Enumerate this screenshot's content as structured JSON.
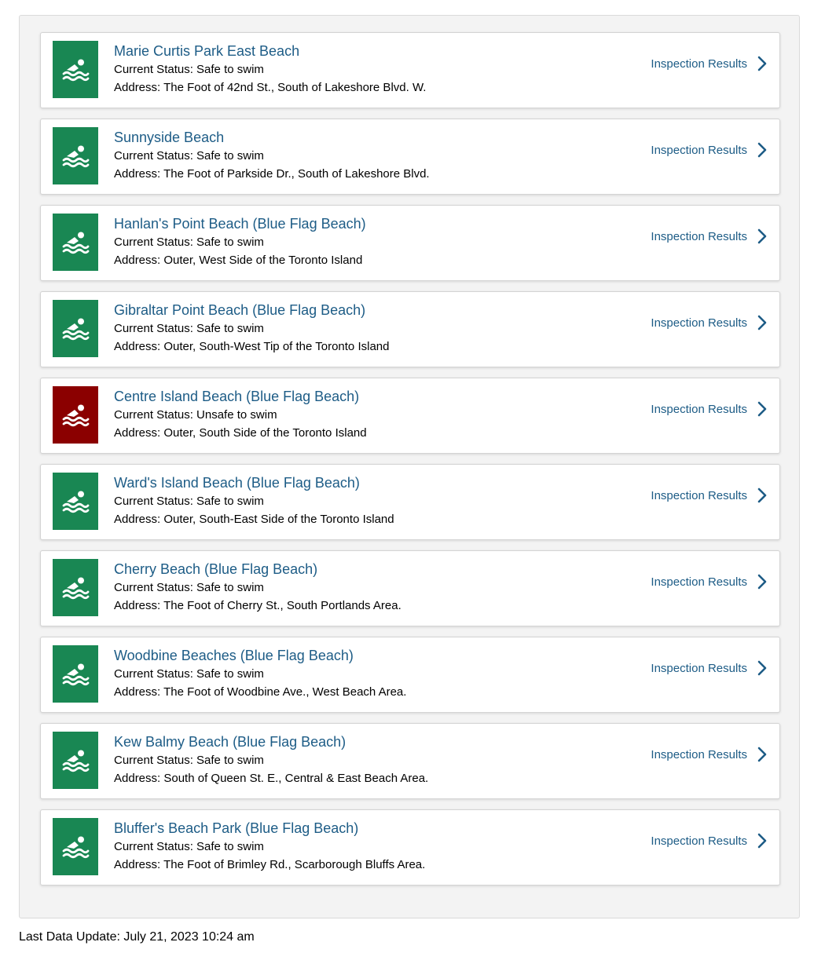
{
  "colors": {
    "safe": "#198753",
    "unsafe": "#8b0000",
    "link": "#1d5c86"
  },
  "icons": {
    "status": "swimmer-icon",
    "link": "chevron-right-icon"
  },
  "inspection_label": "Inspection Results",
  "beaches": [
    {
      "name": "Marie Curtis Park East Beach",
      "status": "Current Status: Safe to swim",
      "address": "Address: The Foot of 42nd St., South of Lakeshore Blvd. W.",
      "state": "safe"
    },
    {
      "name": "Sunnyside Beach",
      "status": "Current Status: Safe to swim",
      "address": "Address: The Foot of Parkside Dr., South of Lakeshore Blvd.",
      "state": "safe"
    },
    {
      "name": "Hanlan's Point Beach (Blue Flag Beach)",
      "status": "Current Status: Safe to swim",
      "address": "Address: Outer, West Side of the Toronto Island",
      "state": "safe"
    },
    {
      "name": "Gibraltar Point Beach (Blue Flag Beach)",
      "status": "Current Status: Safe to swim",
      "address": "Address: Outer, South-West Tip of the Toronto Island",
      "state": "safe"
    },
    {
      "name": "Centre Island Beach (Blue Flag Beach)",
      "status": "Current Status: Unsafe to swim",
      "address": "Address: Outer, South Side of the Toronto Island",
      "state": "unsafe"
    },
    {
      "name": "Ward's Island Beach (Blue Flag Beach)",
      "status": "Current Status: Safe to swim",
      "address": "Address: Outer, South-East Side of the Toronto Island",
      "state": "safe"
    },
    {
      "name": "Cherry Beach (Blue Flag Beach)",
      "status": "Current Status: Safe to swim",
      "address": "Address: The Foot of Cherry St., South Portlands Area.",
      "state": "safe"
    },
    {
      "name": "Woodbine Beaches (Blue Flag Beach)",
      "status": "Current Status: Safe to swim",
      "address": "Address: The Foot of Woodbine Ave., West Beach Area.",
      "state": "safe"
    },
    {
      "name": "Kew Balmy Beach (Blue Flag Beach)",
      "status": "Current Status: Safe to swim",
      "address": "Address: South of Queen St. E., Central & East Beach Area.",
      "state": "safe"
    },
    {
      "name": "Bluffer's Beach Park (Blue Flag Beach)",
      "status": "Current Status: Safe to swim",
      "address": "Address: The Foot of Brimley Rd., Scarborough Bluffs Area.",
      "state": "safe"
    }
  ],
  "footer": {
    "last_update": "Last Data Update: July 21, 2023 10:24 am"
  }
}
